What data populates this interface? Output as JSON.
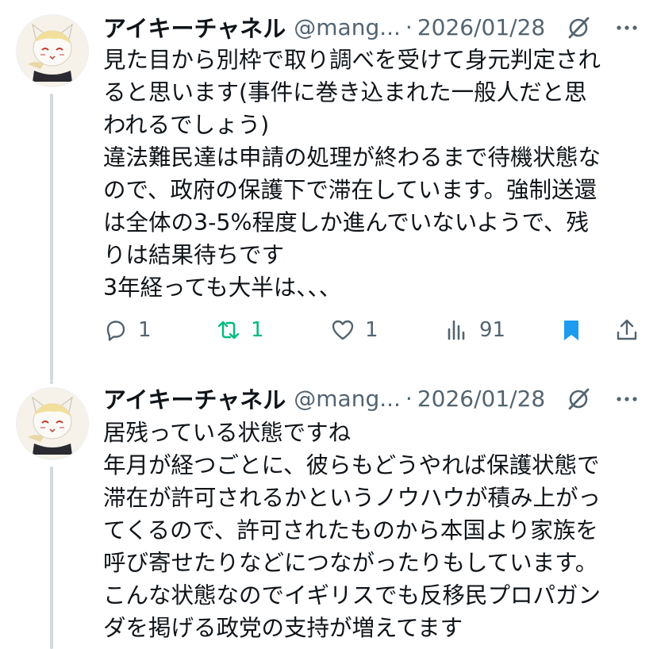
{
  "tweets": [
    {
      "display_name": "アイキーチャネル",
      "handle": "@mang...",
      "separator": "·",
      "date": "2026/01/28",
      "lines": [
        "見た目から別枠で取り調べを受けて身元判定され",
        "ると思います(事件に巻き込まれた一般人だと思",
        "われるでしょう)",
        "違法難民達は申請の処理が終わるまで待機状態な",
        "ので、政府の保護下で滞在しています。強制送還",
        "は全体の3-5%程度しか進んでいないようで、残",
        "りは結果待ちです",
        "3年経っても大半は、、、"
      ],
      "stats": {
        "replies": "1",
        "reposts": "1",
        "likes": "1",
        "views": "91"
      }
    },
    {
      "display_name": "アイキーチャネル",
      "handle": "@mang...",
      "separator": "·",
      "date": "2026/01/28",
      "lines": [
        "居残っている状態ですね",
        "年月が経つごとに、彼らもどうやれば保護状態で",
        "滞在が許可されるかというノウハウが積み上がっ",
        "てくるので、許可されたものから本国より家族を",
        "呼び寄せたりなどにつながったりもしています。",
        "こんな状態なのでイギリスでも反移民プロパガン",
        "ダを掲げる政党の支持が増えてます"
      ]
    }
  ],
  "colors": {
    "text": "#0f1419",
    "muted": "#536471",
    "repost_active": "#00ba7c",
    "bookmark_active": "#1d9bf0",
    "thread_line": "#cfd9de"
  },
  "icons": [
    "cat-avatar-icon",
    "grok-slash-icon",
    "more-icon",
    "reply-icon",
    "repost-icon",
    "like-icon",
    "views-icon",
    "bookmark-icon",
    "share-icon"
  ]
}
